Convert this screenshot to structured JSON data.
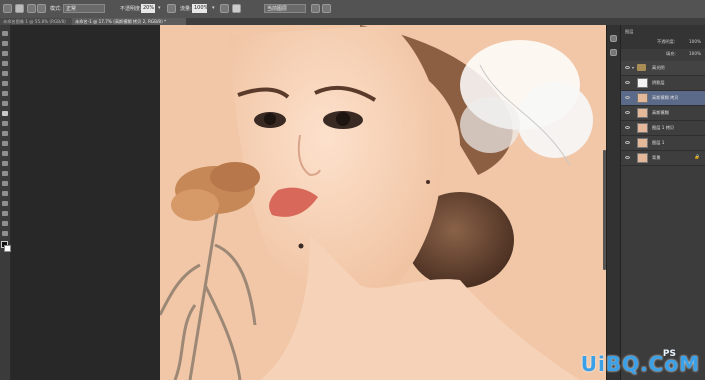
{
  "options_bar": {
    "mode_label": "模式:",
    "mode_value": "正常",
    "opacity_label": "不透明度:",
    "opacity_value": "20%",
    "flow_label": "流量:",
    "flow_value": "100%",
    "sample_value": "当前图层"
  },
  "tabs": [
    {
      "label": "未命名图像 1 @ 55.8% (RGB/8)"
    },
    {
      "label": "未命名-1 @ 17.7% (高斯模糊 拷贝 2, RGB/8) *"
    }
  ],
  "layers": {
    "header_label": "图层",
    "opacity_label": "不透明度:",
    "opacity_value": "100%",
    "fill_label": "填充:",
    "fill_value": "100%",
    "rows": [
      {
        "name": "高光阴",
        "kind": "group"
      },
      {
        "name": "阴影层",
        "kind": "white"
      },
      {
        "name": "高斯模糊 拷贝",
        "kind": "photo",
        "selected": true
      },
      {
        "name": "高斯模糊",
        "kind": "photo"
      },
      {
        "name": "图层 1 拷贝",
        "kind": "photo"
      },
      {
        "name": "图层 1",
        "kind": "photo"
      },
      {
        "name": "背景",
        "kind": "photo"
      }
    ]
  },
  "watermark": {
    "ps_text": "PS",
    "site_text": "UiBQ.CoM"
  },
  "colors": {
    "skin_background": "#f1c6a6",
    "panel_bg": "#3c3c3c",
    "selection": "#5a6a88",
    "watermark_blue": "#3aa0e8"
  }
}
